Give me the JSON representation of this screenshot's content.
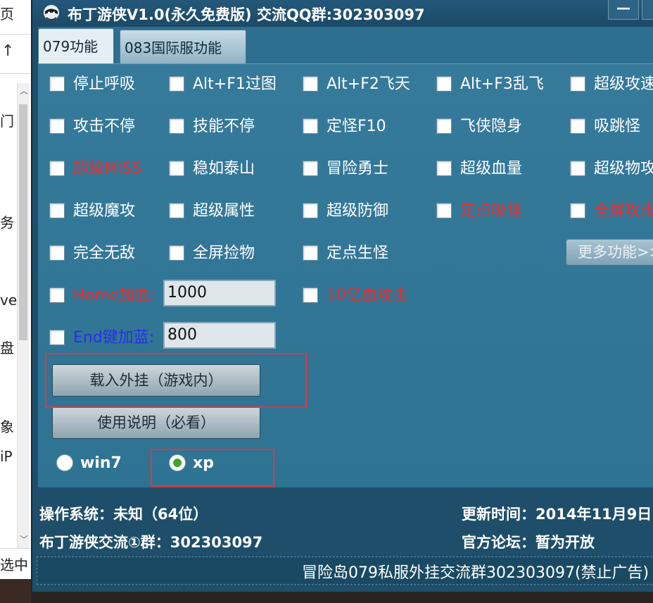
{
  "background_window": {
    "fragments": [
      "页",
      "门",
      "务",
      "ve",
      "盘",
      "象",
      "iP",
      "选中"
    ]
  },
  "window": {
    "title": "布丁游侠V1.0(永久免费版)  交流QQ群:302303097",
    "minimize_label": "—",
    "maximize_label": "□"
  },
  "tabs": [
    {
      "label": "079功能",
      "active": true
    },
    {
      "label": "083国际服功能",
      "active": false
    }
  ],
  "features": {
    "row1": [
      "停止呼吸",
      "Alt+F1过图",
      "Alt+F2飞天",
      "Alt+F3乱飞",
      "超级攻速"
    ],
    "row2": [
      "攻击不停",
      "技能不停",
      "定怪F10",
      "飞侠隐身",
      "吸跳怪"
    ],
    "row3": [
      "超级MISS",
      "稳如泰山",
      "冒险勇士",
      "超级血量",
      "超级物攻"
    ],
    "row4": [
      "超级魔攻",
      "超级属性",
      "超级防御",
      "定点吸怪",
      "全屏攻击"
    ],
    "row5": [
      "完全无敌",
      "全屏捡物",
      "定点生怪"
    ]
  },
  "home_heal": {
    "label": "Home加血:",
    "value": "1000"
  },
  "billion_attack": {
    "label": "10亿血攻击"
  },
  "end_mana": {
    "label": "End键加蓝:",
    "value": "800"
  },
  "more_button": "更多功能>>",
  "buttons": {
    "load": "载入外挂（游戏内）",
    "manual": "使用说明（必看）"
  },
  "os_options": [
    {
      "label": "win7",
      "selected": false
    },
    {
      "label": "xp",
      "selected": true
    }
  ],
  "status": {
    "os_info": "操作系统：未知（64位）",
    "update_time": "更新时间：2014年11月9日",
    "group": "布丁游侠交流①群：302303097",
    "forum": "官方论坛：暂为开放",
    "marquee": "冒险岛079私服外挂交流群302303097(禁止广告)"
  },
  "colors": {
    "window_bg": "#1e4e69",
    "panel_bg": "#367a9b",
    "warning_red": "#ef2b2b",
    "link_blue": "#2a2fe6",
    "highlight_red": "#e8343a"
  }
}
